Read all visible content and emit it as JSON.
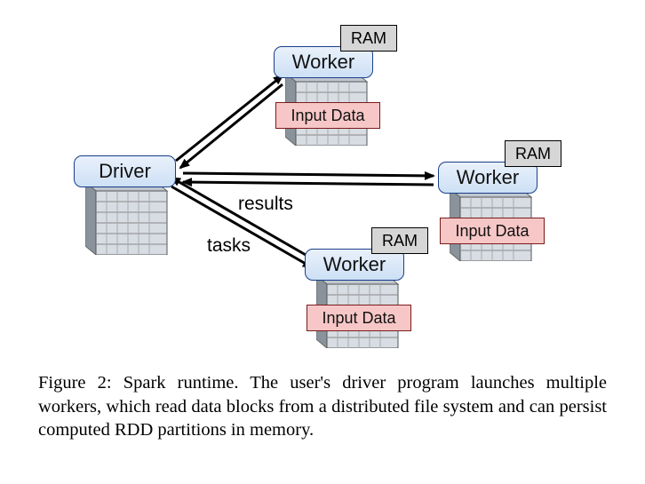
{
  "nodes": {
    "driver": {
      "label": "Driver"
    },
    "worker1": {
      "label": "Worker",
      "ram": "RAM",
      "input": "Input Data"
    },
    "worker2": {
      "label": "Worker",
      "ram": "RAM",
      "input": "Input Data"
    },
    "worker3": {
      "label": "Worker",
      "ram": "RAM",
      "input": "Input Data"
    }
  },
  "edge_labels": {
    "results": "results",
    "tasks": "tasks"
  },
  "caption": "Figure 2: Spark runtime. The user's driver program launches multiple workers, which read data blocks from a distributed file system and can persist computed RDD partitions in memory."
}
